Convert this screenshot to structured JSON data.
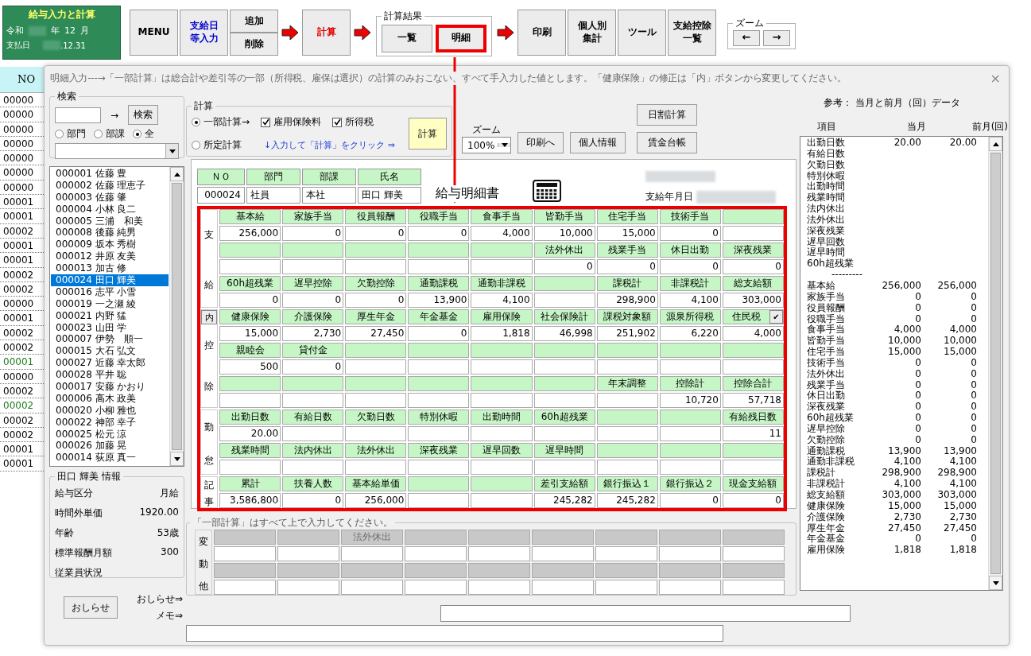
{
  "app_badge": {
    "title": "給与入力と計算",
    "era": "令和",
    "year_label": "年",
    "month": "12",
    "month_label": "月",
    "pay_label": "支払日",
    "pay_date": ".12.31"
  },
  "toolbar": [
    {
      "kind": "button",
      "lines": [
        "MENU"
      ],
      "color": "#000000",
      "highlighted": false
    },
    {
      "kind": "button",
      "lines": [
        "支給日",
        "等入力"
      ],
      "color": "#0000cc",
      "highlighted": false
    },
    {
      "kind": "stack",
      "buttons": [
        {
          "kind": "text",
          "lines": [
            "追加"
          ],
          "color": "#000000",
          "highlighted": false
        },
        {
          "kind": "text",
          "lines": [
            "削除"
          ],
          "color": "#000000",
          "highlighted": false
        }
      ]
    },
    {
      "kind": "arrow"
    },
    {
      "kind": "button",
      "lines": [
        "計算"
      ],
      "color": "#dd0000",
      "highlighted": false
    },
    {
      "kind": "arrow"
    },
    {
      "kind": "group",
      "title": "計算結果",
      "buttons": [
        {
          "kind": "text",
          "lines": [
            "一覧"
          ],
          "color": "#000000",
          "highlighted": false
        },
        {
          "kind": "text",
          "lines": [
            "明細"
          ],
          "color": "#000000",
          "highlighted": true
        }
      ]
    },
    {
      "kind": "arrow"
    },
    {
      "kind": "button",
      "lines": [
        "印刷"
      ],
      "color": "#000000",
      "highlighted": false
    },
    {
      "kind": "button",
      "lines": [
        "個人別",
        "集計"
      ],
      "color": "#000000",
      "highlighted": false
    },
    {
      "kind": "button",
      "lines": [
        "ツール"
      ],
      "color": "#000000",
      "highlighted": false
    },
    {
      "kind": "button",
      "lines": [
        "支給控除",
        "一覧"
      ],
      "color": "#000000",
      "highlighted": false
    },
    {
      "kind": "group",
      "title": "ズーム",
      "buttons": [
        {
          "kind": "glyph",
          "lines": [
            "←"
          ],
          "color": "#000000",
          "highlighted": false
        },
        {
          "kind": "glyph",
          "lines": [
            "→"
          ],
          "color": "#000000",
          "highlighted": false
        }
      ]
    }
  ],
  "sheet_behind": {
    "header": "NO",
    "rows": [
      {
        "text": "00000",
        "color": "#000000"
      },
      {
        "text": "00000",
        "color": "#000000"
      },
      {
        "text": "00000",
        "color": "#000000"
      },
      {
        "text": "00000",
        "color": "#000000"
      },
      {
        "text": "00000",
        "color": "#000000"
      },
      {
        "text": "00000",
        "color": "#000000"
      },
      {
        "text": "00000",
        "color": "#000000"
      },
      {
        "text": "00001",
        "color": "#000000"
      },
      {
        "text": "00001",
        "color": "#000000"
      },
      {
        "text": "00002",
        "color": "#000000"
      },
      {
        "text": "00001",
        "color": "#000000"
      },
      {
        "text": "00001",
        "color": "#000000"
      },
      {
        "text": "00002",
        "color": "#000000"
      },
      {
        "text": "00002",
        "color": "#000000"
      },
      {
        "text": "00000",
        "color": "#000000"
      },
      {
        "text": "00001",
        "color": "#000000"
      },
      {
        "text": "00002",
        "color": "#000000"
      },
      {
        "text": "00002",
        "color": "#000000"
      },
      {
        "text": "00001",
        "color": "#1e7b1e"
      },
      {
        "text": "00000",
        "color": "#000000"
      },
      {
        "text": "00002",
        "color": "#000000"
      },
      {
        "text": "00002",
        "color": "#1e7b1e"
      },
      {
        "text": "00002",
        "color": "#000000"
      },
      {
        "text": "00002",
        "color": "#000000"
      },
      {
        "text": "00001",
        "color": "#000000"
      },
      {
        "text": "00001",
        "color": "#000000"
      }
    ]
  },
  "dialog": {
    "title": "明細入力---→「一部計算」は総合計や差引等の一部（所得税、雇保は選択）の計算のみおこない、すべて手入力した値とします。「健康保険」の修正は「内」ボタンから変更してください。",
    "close": "×",
    "search": {
      "title": "検索",
      "arrow": "→",
      "button": "検索",
      "radios": [
        {
          "label": "部門",
          "selected": false
        },
        {
          "label": "部課",
          "selected": false
        },
        {
          "label": "全",
          "selected": true
        }
      ]
    },
    "employees": [
      {
        "label": "000001 佐藤 豊",
        "selected": false
      },
      {
        "label": "000002 佐藤 理恵子",
        "selected": false
      },
      {
        "label": "000003 佐藤 肇",
        "selected": false
      },
      {
        "label": "000004 小林 良二",
        "selected": false
      },
      {
        "label": "000005 三浦　和美",
        "selected": false
      },
      {
        "label": "000008 後藤 純男",
        "selected": false
      },
      {
        "label": "000009 坂本 秀樹",
        "selected": false
      },
      {
        "label": "000012 井原 友美",
        "selected": false
      },
      {
        "label": "000013 加古 修",
        "selected": false
      },
      {
        "label": "000024 田口 輝美",
        "selected": true
      },
      {
        "label": "000016 志平 小雪",
        "selected": false
      },
      {
        "label": "000019 一之瀬 綾",
        "selected": false
      },
      {
        "label": "000021 内野 猛",
        "selected": false
      },
      {
        "label": "000023 山田 学",
        "selected": false
      },
      {
        "label": "000007 伊勢　順一",
        "selected": false
      },
      {
        "label": "000015 大石 弘文",
        "selected": false
      },
      {
        "label": "000027 近藤 幸太郎",
        "selected": false
      },
      {
        "label": "000028 平井 聡",
        "selected": false
      },
      {
        "label": "000017 安藤 かおり",
        "selected": false
      },
      {
        "label": "000006 高木 政美",
        "selected": false
      },
      {
        "label": "000020 小柳 雅也",
        "selected": false
      },
      {
        "label": "000022 神部 幸子",
        "selected": false
      },
      {
        "label": "000025 松元 涼",
        "selected": false
      },
      {
        "label": "000026 加藤 晃",
        "selected": false
      },
      {
        "label": "000014 荻原 真一",
        "selected": false
      }
    ],
    "info": {
      "title": "田口 輝美 情報",
      "rows": [
        {
          "label": "給与区分",
          "value": "月給"
        },
        {
          "label": "時間外単価",
          "value": "1920.00"
        },
        {
          "label": "年齢",
          "value": "53歳"
        },
        {
          "label": "標準報酬月額",
          "value": "300"
        },
        {
          "label": "従業員状況"
        }
      ]
    },
    "notice_button": "おしらせ",
    "notice_link": "おしらせ⇒",
    "memo_link": "メモ⇒",
    "calc": {
      "title": "計算",
      "modes": [
        {
          "label": "一部計算→",
          "selected": true
        },
        {
          "label": "所定計算",
          "selected": false
        }
      ],
      "options": [
        {
          "label": "雇用保険料",
          "checked": true
        },
        {
          "label": "所得税",
          "checked": true
        }
      ],
      "hint": "↓入力して「計算」をクリック ⇒",
      "button": "計算"
    },
    "zoom": {
      "label": "ズーム",
      "value": "100%"
    },
    "actions": [
      "印刷へ",
      "個人情報"
    ],
    "side_actions": [
      "日割計算",
      "賃金台帳"
    ],
    "slip": {
      "id_headers": [
        "ＮＯ",
        "部門",
        "部課",
        "氏名"
      ],
      "id_values": [
        "000024",
        "社員",
        "本社",
        "田口 輝美"
      ],
      "title": "給与明細書",
      "date_label": "支給年月日",
      "highlighted": true,
      "sections": [
        {
          "label": "支給",
          "rows": [
            {
              "kind": "header",
              "cells": [
                "基本給",
                "家族手当",
                "役員報酬",
                "役職手当",
                "食事手当",
                "皆勤手当",
                "住宅手当",
                "技術手当",
                null
              ]
            },
            {
              "kind": "value",
              "cells": [
                "256,000",
                "0",
                "0",
                "0",
                "4,000",
                "10,000",
                "15,000",
                "0",
                null
              ]
            },
            {
              "kind": "header",
              "cells": [
                null,
                null,
                null,
                null,
                null,
                "法外休出",
                "残業手当",
                "休日出勤",
                "深夜残業"
              ]
            },
            {
              "kind": "value",
              "cells": [
                null,
                null,
                null,
                null,
                null,
                "0",
                "0",
                "0",
                "0"
              ]
            },
            {
              "kind": "header",
              "cells": [
                "60h超残業",
                "遅早控除",
                "欠勤控除",
                "通勤課税",
                "通勤非課税",
                null,
                "課税計",
                "非課税計",
                "総支給額"
              ]
            },
            {
              "kind": "value",
              "cells": [
                "0",
                "0",
                "0",
                "13,900",
                "4,100",
                null,
                "298,900",
                "4,100",
                "303,000"
              ]
            }
          ]
        },
        {
          "label": "控除",
          "inner_button": "内",
          "corner_button": "✔",
          "rows": [
            {
              "kind": "header",
              "cells": [
                "健康保険",
                "介護保険",
                "厚生年金",
                "年金基金",
                "雇用保険",
                "社会保険計",
                "課税対象額",
                "源泉所得税",
                "住民税"
              ]
            },
            {
              "kind": "value",
              "cells": [
                "15,000",
                "2,730",
                "27,450",
                "0",
                "1,818",
                "46,998",
                "251,902",
                "6,220",
                "4,000"
              ]
            },
            {
              "kind": "header",
              "cells": [
                "親睦会",
                "貸付金",
                null,
                null,
                null,
                null,
                null,
                null,
                null
              ]
            },
            {
              "kind": "value",
              "cells": [
                "500",
                "0",
                null,
                null,
                null,
                null,
                null,
                null,
                null
              ]
            },
            {
              "kind": "header",
              "cells": [
                null,
                null,
                null,
                null,
                null,
                null,
                "年末調整",
                "控除計",
                "控除合計"
              ]
            },
            {
              "kind": "value",
              "cells": [
                null,
                null,
                null,
                null,
                null,
                null,
                null,
                "10,720",
                "57,718"
              ]
            }
          ]
        },
        {
          "label": "勤怠",
          "rows": [
            {
              "kind": "header",
              "cells": [
                "出勤日数",
                "有給日数",
                "欠勤日数",
                "特別休暇",
                "出勤時間",
                "60h超残業",
                null,
                null,
                "有給残日数"
              ]
            },
            {
              "kind": "value",
              "cells": [
                "20.00",
                null,
                null,
                null,
                null,
                null,
                null,
                null,
                "11"
              ]
            },
            {
              "kind": "header",
              "cells": [
                "残業時間",
                "法内休出",
                "法外休出",
                "深夜残業",
                "遅早回数",
                "遅早時間",
                null,
                null,
                null
              ]
            },
            {
              "kind": "value",
              "cells": [
                null,
                null,
                null,
                null,
                null,
                null,
                null,
                null,
                null
              ]
            }
          ]
        },
        {
          "label": "記事",
          "rows": [
            {
              "kind": "header",
              "cells": [
                "累計",
                "扶養人数",
                "基本給単価",
                null,
                null,
                "差引支給額",
                "銀行振込１",
                "銀行振込２",
                "現金支給額"
              ]
            },
            {
              "kind": "value",
              "cells": [
                "3,586,800",
                "0",
                "256,000",
                null,
                null,
                "245,282",
                "245,282",
                "0",
                "0"
              ]
            }
          ]
        }
      ]
    },
    "variable": {
      "title": "「一部計算」はすべて上で入力してください。",
      "label": "変動他",
      "disabled": true,
      "rows": [
        {
          "kind": "header",
          "cells": [
            null,
            null,
            "法外休出",
            null,
            null,
            null,
            null,
            null,
            null
          ]
        },
        {
          "kind": "value",
          "cells": [
            null,
            null,
            null,
            null,
            null,
            null,
            null,
            null,
            null
          ]
        },
        {
          "kind": "header",
          "cells": [
            null,
            null,
            null,
            null,
            null,
            null,
            null,
            null,
            null
          ]
        },
        {
          "kind": "value",
          "cells": [
            null,
            null,
            null,
            null,
            null,
            null,
            null,
            null,
            null
          ]
        }
      ]
    },
    "reference": {
      "title": "参考： 当月と前月（回）データ",
      "columns": [
        "項目",
        "当月",
        "前月(回)"
      ],
      "rows": [
        {
          "kind": "item",
          "label": "出勤日数",
          "current": "20.00",
          "previous": "20.00"
        },
        {
          "kind": "item",
          "label": "有給日数"
        },
        {
          "kind": "item",
          "label": "欠勤日数"
        },
        {
          "kind": "item",
          "label": "特別休暇"
        },
        {
          "kind": "item",
          "label": "出勤時間"
        },
        {
          "kind": "item",
          "label": "残業時間"
        },
        {
          "kind": "item",
          "label": "法内休出"
        },
        {
          "kind": "item",
          "label": "法外休出"
        },
        {
          "kind": "item",
          "label": "深夜残業"
        },
        {
          "kind": "item",
          "label": "遅早回数"
        },
        {
          "kind": "item",
          "label": "遅早時間"
        },
        {
          "kind": "item",
          "label": "60h超残業"
        },
        {
          "kind": "separator",
          "label": "---------"
        },
        {
          "kind": "item",
          "label": "基本給",
          "current": "256,000",
          "previous": "256,000"
        },
        {
          "kind": "item",
          "label": "家族手当",
          "current": "0",
          "previous": "0"
        },
        {
          "kind": "item",
          "label": "役員報酬",
          "current": "0",
          "previous": "0"
        },
        {
          "kind": "item",
          "label": "役職手当",
          "current": "0",
          "previous": "0"
        },
        {
          "kind": "item",
          "label": "食事手当",
          "current": "4,000",
          "previous": "4,000"
        },
        {
          "kind": "item",
          "label": "皆勤手当",
          "current": "10,000",
          "previous": "10,000"
        },
        {
          "kind": "item",
          "label": "住宅手当",
          "current": "15,000",
          "previous": "15,000"
        },
        {
          "kind": "item",
          "label": "技術手当",
          "current": "0",
          "previous": "0"
        },
        {
          "kind": "item",
          "label": "法外休出",
          "current": "0",
          "previous": "0"
        },
        {
          "kind": "item",
          "label": "残業手当",
          "current": "0",
          "previous": "0"
        },
        {
          "kind": "item",
          "label": "休日出勤",
          "current": "0",
          "previous": "0"
        },
        {
          "kind": "item",
          "label": "深夜残業",
          "current": "0",
          "previous": "0"
        },
        {
          "kind": "item",
          "label": "60h超残業",
          "current": "0",
          "previous": "0"
        },
        {
          "kind": "item",
          "label": "遅早控除",
          "current": "0",
          "previous": "0"
        },
        {
          "kind": "item",
          "label": "欠勤控除",
          "current": "0",
          "previous": "0"
        },
        {
          "kind": "item",
          "label": "通勤課税",
          "current": "13,900",
          "previous": "13,900"
        },
        {
          "kind": "item",
          "label": "通勤非課税",
          "current": "4,100",
          "previous": "4,100"
        },
        {
          "kind": "item",
          "label": "課税計",
          "current": "298,900",
          "previous": "298,900"
        },
        {
          "kind": "item",
          "label": "非課税計",
          "current": "4,100",
          "previous": "4,100"
        },
        {
          "kind": "item",
          "label": "総支給額",
          "current": "303,000",
          "previous": "303,000"
        },
        {
          "kind": "item",
          "label": "健康保険",
          "current": "15,000",
          "previous": "15,000"
        },
        {
          "kind": "item",
          "label": "介護保険",
          "current": "2,730",
          "previous": "2,730"
        },
        {
          "kind": "item",
          "label": "厚生年金",
          "current": "27,450",
          "previous": "27,450"
        },
        {
          "kind": "item",
          "label": "年金基金",
          "current": "0",
          "previous": "0"
        },
        {
          "kind": "item",
          "label": "雇用保険",
          "current": "1,818",
          "previous": "1,818"
        }
      ]
    }
  }
}
